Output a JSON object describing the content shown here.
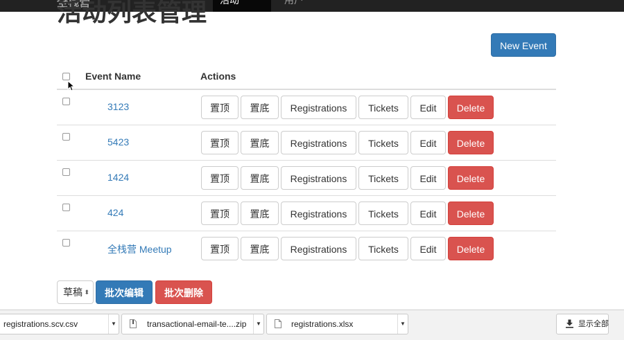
{
  "navbar": {
    "brand": "全栈营",
    "active_tab": "活动",
    "next_tab": "用户"
  },
  "page": {
    "title": "活动列表管理",
    "new_event_label": "New Event"
  },
  "table": {
    "headers": {
      "event_name": "Event Name",
      "actions": "Actions"
    },
    "action_labels": {
      "top": "置顶",
      "bottom": "置底",
      "registrations": "Registrations",
      "tickets": "Tickets",
      "edit": "Edit",
      "delete": "Delete"
    },
    "rows": [
      {
        "name": "3123"
      },
      {
        "name": "5423"
      },
      {
        "name": "1424"
      },
      {
        "name": "424"
      },
      {
        "name": "全栈营 Meetup"
      }
    ]
  },
  "bulk": {
    "status_selected": "草稿",
    "edit_label": "批次编辑",
    "delete_label": "批次删除"
  },
  "downloads": {
    "items": [
      {
        "filename": "registrations.scv.csv",
        "icon": "none"
      },
      {
        "filename": "transactional-email-te....zip",
        "icon": "zip-file-icon"
      },
      {
        "filename": "registrations.xlsx",
        "icon": "file-icon"
      }
    ],
    "show_all_label": "显示全部"
  },
  "colors": {
    "primary": "#337ab7",
    "danger": "#d9534f",
    "navbar": "#222222"
  }
}
